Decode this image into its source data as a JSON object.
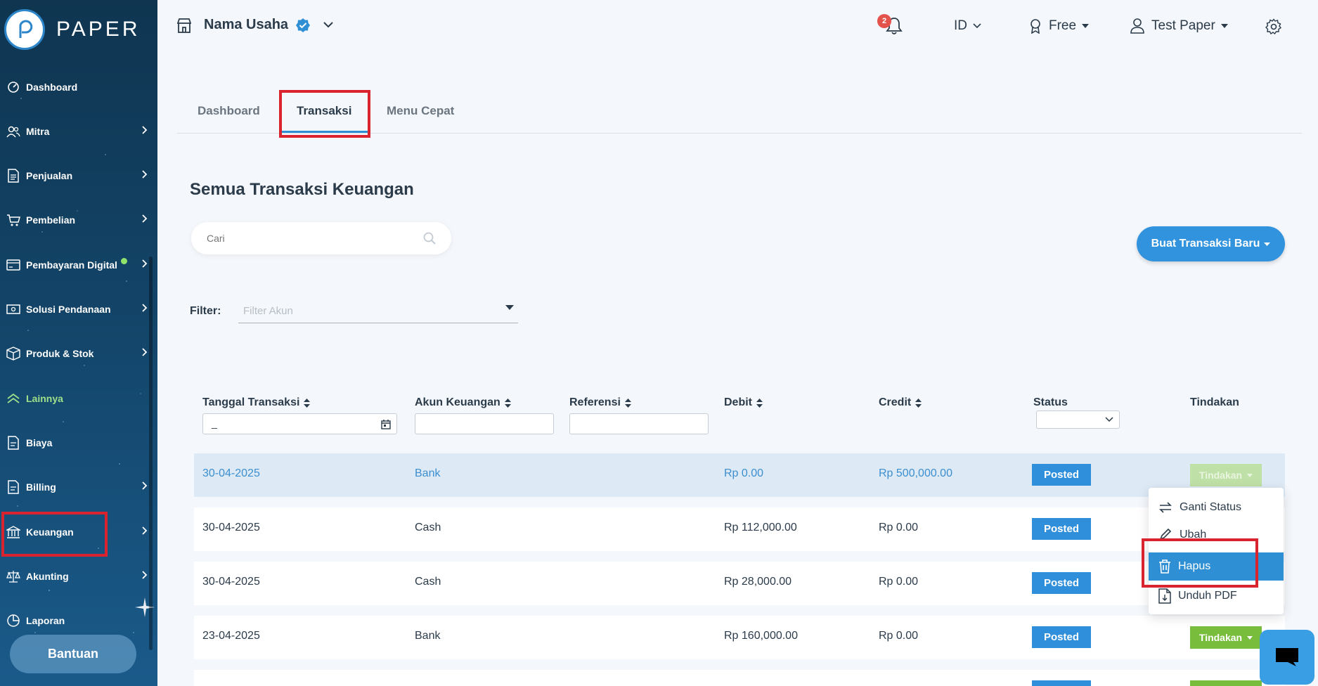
{
  "app": {
    "logo_text": "PAPER",
    "brand_color": "#2e8fd5"
  },
  "sidebar": {
    "items": [
      {
        "label": "Dashboard",
        "icon": "dashboard-icon"
      },
      {
        "label": "Mitra",
        "icon": "users-icon"
      },
      {
        "label": "Penjualan",
        "icon": "document-icon"
      },
      {
        "label": "Pembelian",
        "icon": "cart-icon"
      },
      {
        "label": "Pembayaran Digital",
        "icon": "card-icon"
      },
      {
        "label": "Solusi Pendanaan",
        "icon": "money-icon"
      },
      {
        "label": "Produk & Stok",
        "icon": "box-icon"
      },
      {
        "label": "Lainnya",
        "icon": "chevron-up-icon"
      },
      {
        "label": "Biaya",
        "icon": "document-icon"
      },
      {
        "label": "Billing",
        "icon": "document-icon"
      },
      {
        "label": "Keuangan",
        "icon": "bank-icon"
      },
      {
        "label": "Akunting",
        "icon": "scale-icon"
      },
      {
        "label": "Laporan",
        "icon": "pie-icon"
      }
    ],
    "help_button": "Bantuan"
  },
  "topbar": {
    "business_name": "Nama Usaha",
    "notification_count": "2",
    "language": "ID",
    "plan": "Free",
    "user": "Test Paper"
  },
  "tabs": [
    {
      "label": "Dashboard"
    },
    {
      "label": "Transaksi"
    },
    {
      "label": "Menu Cepat"
    }
  ],
  "main": {
    "title": "Semua Transaksi Keuangan",
    "search_placeholder": "Cari",
    "new_button": "Buat Transaksi Baru",
    "filter_label": "Filter:",
    "filter_placeholder": "Filter Akun"
  },
  "table": {
    "headers": [
      "Tanggal Transaksi",
      "Akun Keuangan",
      "Referensi",
      "Debit",
      "Credit",
      "Status",
      "Tindakan"
    ],
    "date_filter_value": "_",
    "rows": [
      {
        "date": "30-04-2025",
        "account": "Bank",
        "debit": "Rp 0.00",
        "credit": "Rp 500,000.00",
        "status": "Posted",
        "action": "Tindakan"
      },
      {
        "date": "30-04-2025",
        "account": "Cash",
        "debit": "Rp 112,000.00",
        "credit": "Rp 0.00",
        "status": "Posted",
        "action": "Tindakan"
      },
      {
        "date": "30-04-2025",
        "account": "Cash",
        "debit": "Rp 28,000.00",
        "credit": "Rp 0.00",
        "status": "Posted",
        "action": "Tindakan"
      },
      {
        "date": "23-04-2025",
        "account": "Bank",
        "debit": "Rp 160,000.00",
        "credit": "Rp 0.00",
        "status": "Posted",
        "action": "Tindakan"
      }
    ]
  },
  "dropdown": {
    "items": [
      {
        "label": "Ganti Status",
        "icon": "swap-icon"
      },
      {
        "label": "Ubah",
        "icon": "pencil-icon"
      },
      {
        "label": "Hapus",
        "icon": "trash-icon"
      },
      {
        "label": "Unduh PDF",
        "icon": "pdf-icon"
      }
    ]
  }
}
